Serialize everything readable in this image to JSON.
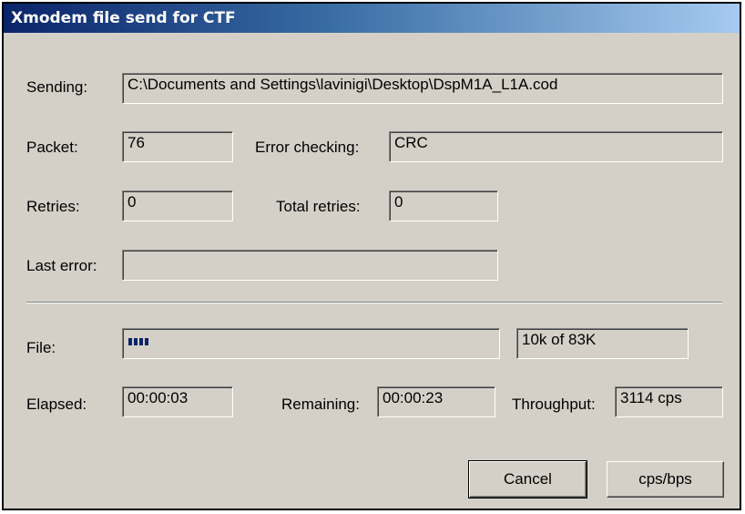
{
  "window": {
    "title": "Xmodem file send for CTF"
  },
  "labels": {
    "sending": "Sending:",
    "packet": "Packet:",
    "error_checking": "Error checking:",
    "retries": "Retries:",
    "total_retries": "Total retries:",
    "last_error": "Last error:",
    "file": "File:",
    "elapsed": "Elapsed:",
    "remaining": "Remaining:",
    "throughput": "Throughput:"
  },
  "values": {
    "sending": "C:\\Documents and Settings\\lavinigi\\Desktop\\DspM1A_L1A.cod",
    "packet": "76",
    "error_checking": "CRC",
    "retries": "0",
    "total_retries": "0",
    "last_error": "",
    "file_size": "10k of 83K",
    "elapsed": "00:00:03",
    "remaining": "00:00:23",
    "throughput": "3114 cps"
  },
  "progress": {
    "fraction": 0.12,
    "color": "#0a246a"
  },
  "buttons": {
    "cancel": "Cancel",
    "cps_bps": "cps/bps"
  }
}
